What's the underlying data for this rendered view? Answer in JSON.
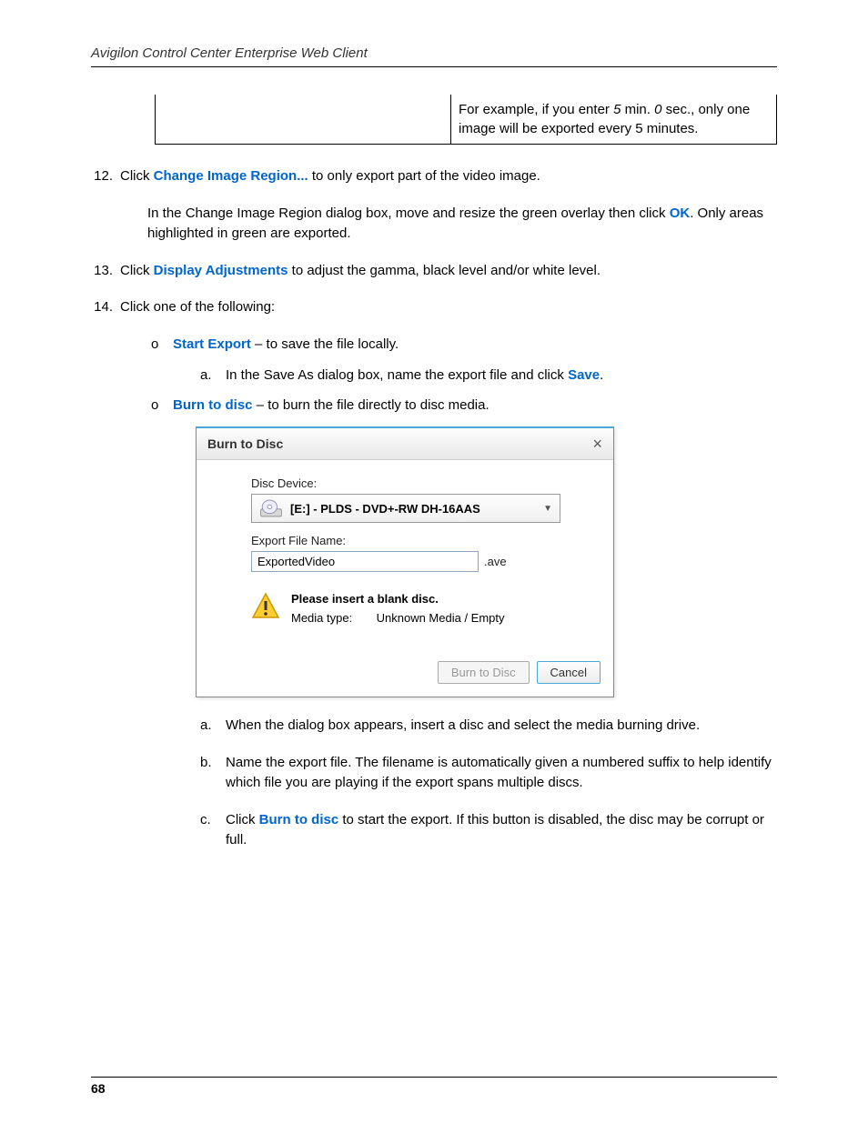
{
  "header": {
    "title": "Avigilon Control Center Enterprise Web Client"
  },
  "table": {
    "example_text_1": "For example, if you enter ",
    "example_min": "5",
    "example_mid": " min. ",
    "example_sec": "0",
    "example_text_2": " sec., only one image will be exported every 5 minutes."
  },
  "step12": {
    "num": "12.",
    "pre": "Click ",
    "link": "Change Image Region...",
    "post": " to only export part of the video image."
  },
  "step12_detail": {
    "pre": "In the Change Image Region dialog box, move and resize the green overlay then click ",
    "ok": "OK",
    "post": ". Only areas highlighted in green are exported."
  },
  "step13": {
    "num": "13.",
    "pre": "Click ",
    "link": "Display Adjustments",
    "post": " to adjust the gamma, black level and/or white level."
  },
  "step14": {
    "num": "14.",
    "text": "Click one of the following:"
  },
  "sub1": {
    "marker": "o",
    "link": "Start Export",
    "post": " – to save the file locally."
  },
  "sub1a": {
    "marker": "a.",
    "pre": "In the Save As dialog box, name the export file and click ",
    "save": "Save",
    "post": "."
  },
  "sub2": {
    "marker": "o",
    "link": "Burn to disc",
    "post": " – to burn the file directly to disc media."
  },
  "dialog": {
    "title": "Burn to Disc",
    "close": "×",
    "disc_label": "Disc Device:",
    "disc_value": "[E:] - PLDS - DVD+-RW DH-16AAS",
    "filename_label": "Export File Name:",
    "filename_value": "ExportedVideo",
    "file_ext": ".ave",
    "warn_title": "Please insert a blank disc.",
    "media_label": "Media type:",
    "media_value": "Unknown Media / Empty",
    "btn_burn": "Burn to Disc",
    "btn_cancel": "Cancel"
  },
  "sub2a": {
    "marker": "a.",
    "text": "When the dialog box appears, insert a disc and select the media burning drive."
  },
  "sub2b": {
    "marker": "b.",
    "text": "Name the export file. The filename is automatically given a numbered suffix to help identify which file you are playing if the export spans multiple discs."
  },
  "sub2c": {
    "marker": "c.",
    "pre": "Click ",
    "link": "Burn to disc",
    "post": " to start the export. If this button is disabled, the disc may be corrupt or full."
  },
  "footer": {
    "page": "68"
  }
}
